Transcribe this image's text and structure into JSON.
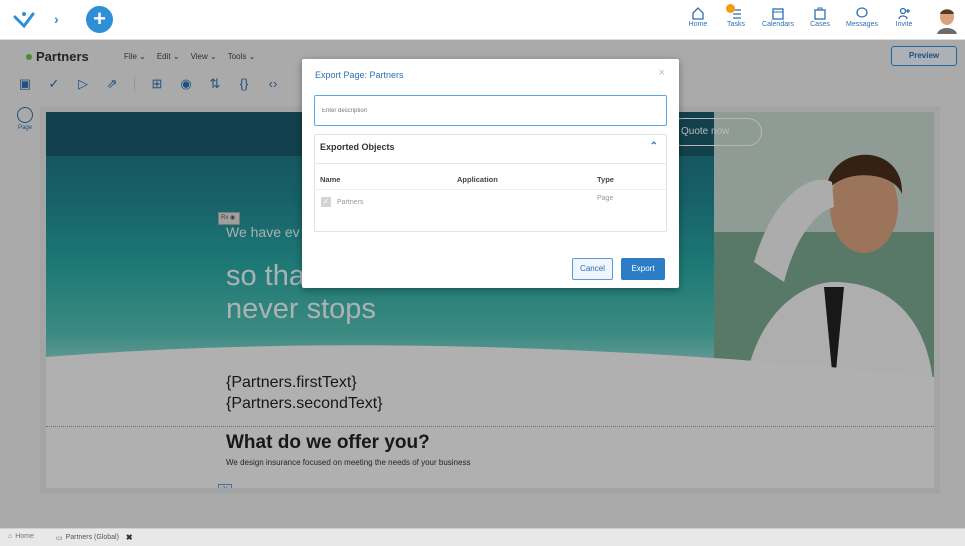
{
  "topnav": {
    "items": [
      {
        "label": "Home",
        "icon": "home-icon"
      },
      {
        "label": "Tasks",
        "icon": "tasks-icon"
      },
      {
        "label": "Calendars",
        "icon": "calendar-icon"
      },
      {
        "label": "Cases",
        "icon": "cases-icon"
      },
      {
        "label": "Messages",
        "icon": "messages-icon"
      },
      {
        "label": "Invite",
        "icon": "invite-icon"
      }
    ]
  },
  "page": {
    "name": "Partners",
    "menus": [
      "File",
      "Edit",
      "View",
      "Tools"
    ],
    "preview_label": "Preview",
    "rail_label": "Page"
  },
  "canvas": {
    "quote_button": "Quote now",
    "rx_tag": "Rx",
    "hero_small": "We have ev",
    "hero_big_line1": "so tha",
    "hero_big_line2": "never stops",
    "first_text": "{Partners.firstText}",
    "second_text": "{Partners.secondText}",
    "offer_title": "What do we offer you?",
    "offer_subtitle": "We design insurance focused on meeting the needs of your business",
    "js_tag": "Js"
  },
  "modal": {
    "title": "Export Page: Partners",
    "close": "×",
    "description_placeholder": "Enter description",
    "objects_title": "Exported Objects",
    "columns": [
      "Name",
      "Application",
      "Type"
    ],
    "rows": [
      {
        "name": "Partners",
        "application": "",
        "type": "Page"
      }
    ],
    "cancel_label": "Cancel",
    "export_label": "Export"
  },
  "bottom_tabs": [
    {
      "label": "Home"
    },
    {
      "label": "Partners (Global)"
    }
  ],
  "colors": {
    "accent": "#2d8fd5",
    "badge": "#f39c12",
    "status_dot": "#6bbf4e"
  }
}
